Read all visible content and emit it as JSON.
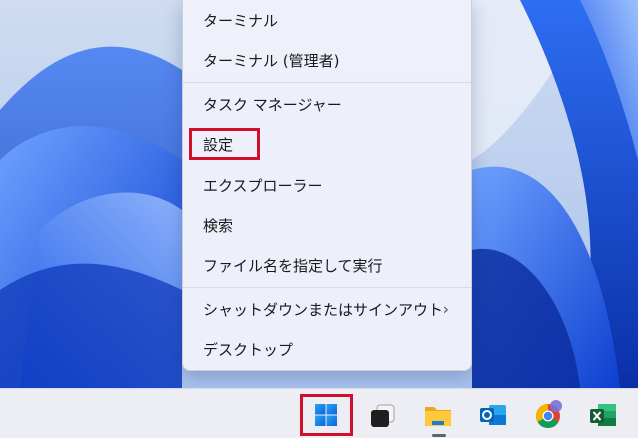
{
  "context_menu": {
    "items": [
      {
        "label": "ターミナル"
      },
      {
        "label": "ターミナル (管理者)"
      },
      {
        "label": "タスク マネージャー"
      },
      {
        "label": "設定"
      },
      {
        "label": "エクスプローラー"
      },
      {
        "label": "検索"
      },
      {
        "label": "ファイル名を指定して実行"
      },
      {
        "label": "シャットダウンまたはサインアウト",
        "chevron": "›"
      },
      {
        "label": "デスクトップ"
      }
    ]
  },
  "taskbar": {
    "icons": [
      {
        "name": "windows-start-icon"
      },
      {
        "name": "task-view-icon"
      },
      {
        "name": "file-explorer-icon"
      },
      {
        "name": "outlook-icon"
      },
      {
        "name": "chrome-icon"
      },
      {
        "name": "excel-icon"
      }
    ]
  },
  "colors": {
    "highlight": "#d0102a",
    "wallpaper_blue": "#1f5fe6",
    "taskbar_bg": "#eceef3"
  }
}
